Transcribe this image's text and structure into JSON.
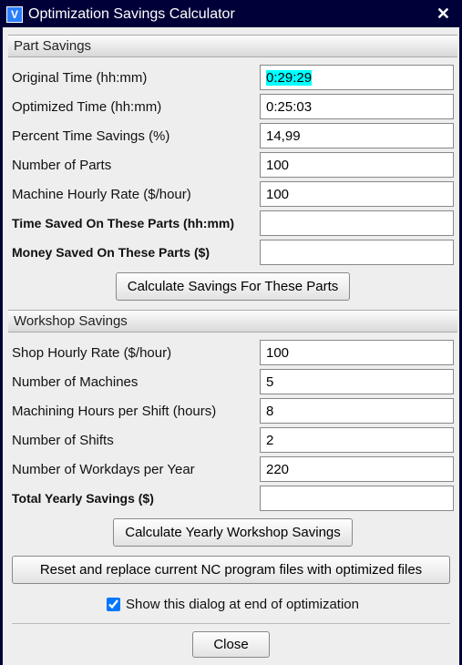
{
  "window": {
    "title": "Optimization Savings Calculator"
  },
  "part_savings": {
    "legend": "Part Savings",
    "original_time_label": "Original Time (hh:mm)",
    "original_time_value": "0:29:29",
    "optimized_time_label": "Optimized Time (hh:mm)",
    "optimized_time_value": "0:25:03",
    "percent_savings_label": "Percent Time Savings (%)",
    "percent_savings_value": "14,99",
    "num_parts_label": "Number of Parts",
    "num_parts_value": "100",
    "machine_rate_label": "Machine Hourly Rate ($/hour)",
    "machine_rate_value": "100",
    "time_saved_label": "Time Saved On These Parts (hh:mm)",
    "time_saved_value": "",
    "money_saved_label": "Money Saved On These Parts ($)",
    "money_saved_value": "",
    "calc_button": "Calculate Savings For These Parts"
  },
  "workshop_savings": {
    "legend": "Workshop Savings",
    "shop_rate_label": "Shop Hourly Rate ($/hour)",
    "shop_rate_value": "100",
    "num_machines_label": "Number of Machines",
    "num_machines_value": "5",
    "hours_per_shift_label": "Machining Hours per Shift (hours)",
    "hours_per_shift_value": "8",
    "num_shifts_label": "Number of Shifts",
    "num_shifts_value": "2",
    "workdays_label": "Number of Workdays per Year",
    "workdays_value": "220",
    "total_yearly_label": "Total Yearly Savings ($)",
    "total_yearly_value": "",
    "calc_button": "Calculate Yearly Workshop Savings"
  },
  "footer": {
    "reset_button": "Reset and replace current NC program files with optimized files",
    "show_dialog_label": "Show this dialog at end of optimization",
    "show_dialog_checked": true,
    "close_button": "Close"
  }
}
